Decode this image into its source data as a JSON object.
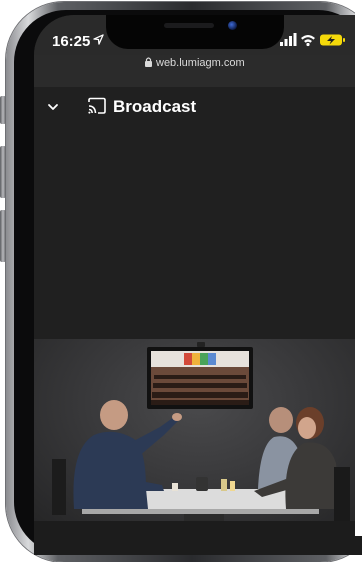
{
  "status_bar": {
    "time": "16:25",
    "icons": [
      "location-arrow-icon",
      "signal-icon",
      "wifi-icon",
      "battery-charging-icon"
    ]
  },
  "browser": {
    "url": "web.lumiagm.com"
  },
  "app_bar": {
    "title": "Broadcast",
    "collapse_icon": "chevron-down-icon",
    "cast_icon": "cast-icon"
  },
  "video": {
    "description_icon": "meeting-room-video"
  },
  "colors": {
    "background": "#202020",
    "accent_battery": "#f5d90a",
    "text": "#ffffff"
  }
}
